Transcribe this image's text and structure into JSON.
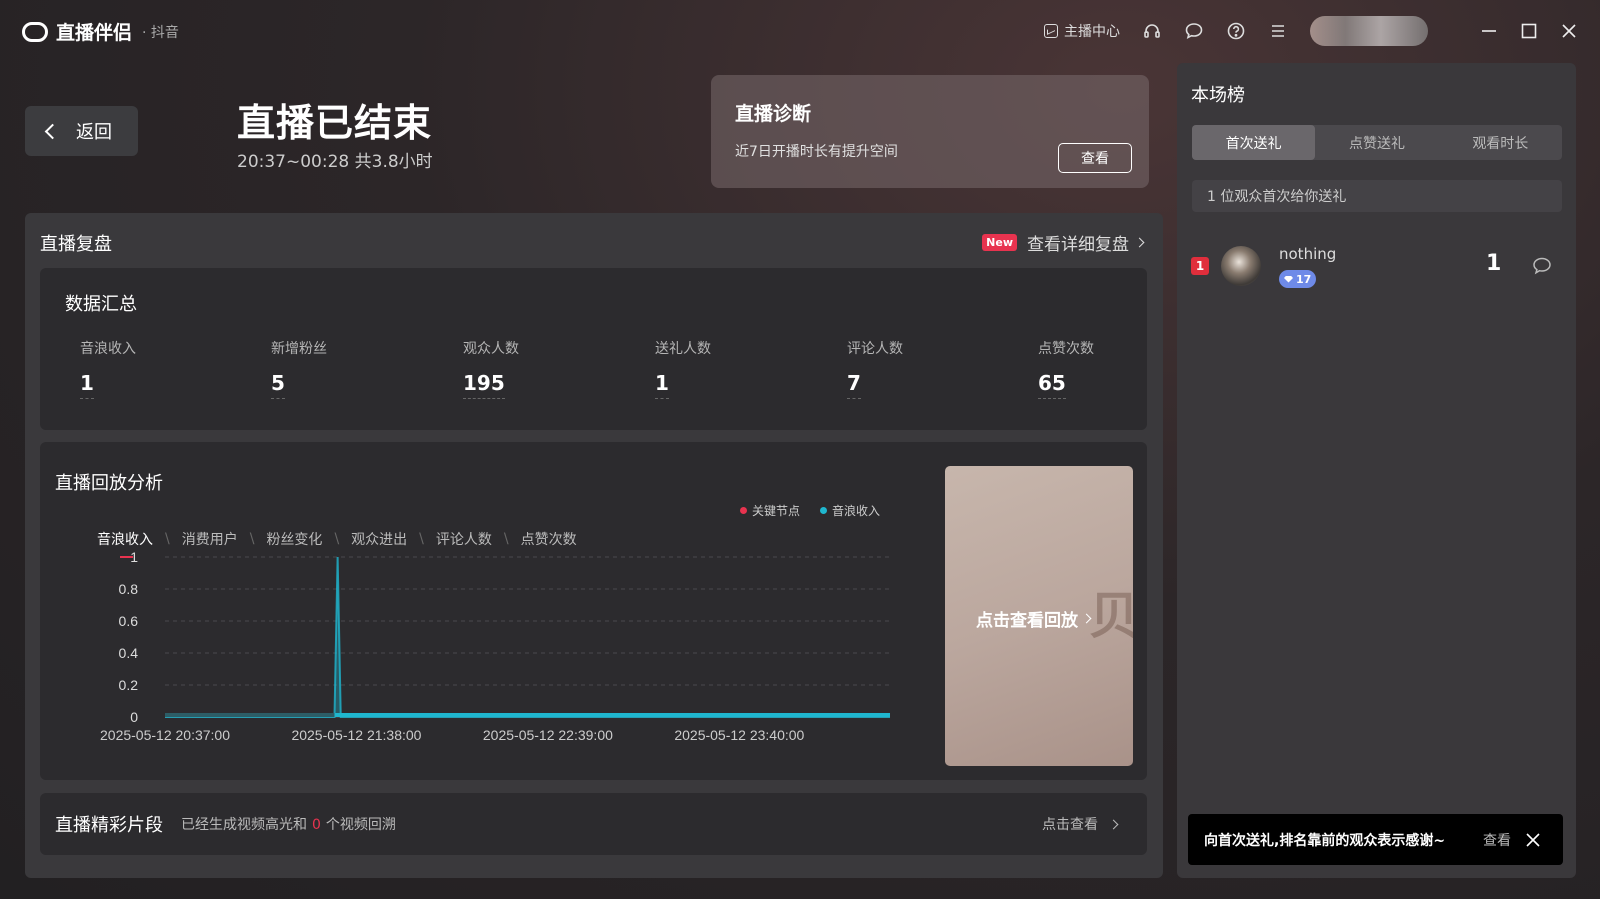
{
  "app": {
    "title": "直播伴侣",
    "platform": "· 抖音",
    "anchor_center": "主播中心"
  },
  "header": {
    "back_label": "返回",
    "status_title": "直播已结束",
    "time_range": "20:37~00:28 共3.8小时"
  },
  "diagnosis": {
    "title": "直播诊断",
    "desc": "近7日开播时长有提升空间",
    "button": "查看"
  },
  "review": {
    "title": "直播复盘",
    "new_badge": "New",
    "detail_link": "查看详细复盘",
    "summary": {
      "title": "数据汇总",
      "metrics": [
        {
          "label": "音浪收入",
          "value": "1"
        },
        {
          "label": "新增粉丝",
          "value": "5"
        },
        {
          "label": "观众人数",
          "value": "195"
        },
        {
          "label": "送礼人数",
          "value": "1"
        },
        {
          "label": "评论人数",
          "value": "7"
        },
        {
          "label": "点赞次数",
          "value": "65"
        }
      ]
    },
    "replay": {
      "title": "直播回放分析",
      "legend": [
        {
          "name": "关键节点",
          "color": "#e8334f"
        },
        {
          "name": "音浪收入",
          "color": "#1fb7cf"
        }
      ],
      "tabs": [
        "音浪收入",
        "消费用户",
        "粉丝变化",
        "观众进出",
        "评论人数",
        "点赞次数"
      ],
      "thumb_label": "点击查看回放"
    },
    "highlights": {
      "title": "直播精彩片段",
      "desc_prefix": "已经生成视频高光和",
      "count": "0",
      "desc_suffix": "个视频回溯",
      "link": "点击查看"
    }
  },
  "chart_data": {
    "type": "area",
    "x_ticks": [
      "2025-05-12 20:37:00",
      "2025-05-12 21:38:00",
      "2025-05-12 22:39:00",
      "2025-05-12 23:40:00"
    ],
    "y_ticks": [
      "0",
      "0.2",
      "0.4",
      "0.6",
      "0.8",
      "1"
    ],
    "ylim": [
      0,
      1
    ],
    "grid": true,
    "series": [
      {
        "name": "音浪收入",
        "color": "#1fb7cf",
        "x": [
          "2025-05-12 20:37:00",
          "2025-05-12 21:31:00",
          "2025-05-12 21:32:00",
          "2025-05-12 21:33:00",
          "2025-05-13 00:28:00"
        ],
        "values": [
          0,
          0,
          1,
          0,
          0
        ]
      }
    ]
  },
  "ranking": {
    "title": "本场榜",
    "tabs": [
      "首次送礼",
      "点赞送礼",
      "观看时长"
    ],
    "info": "1 位观众首次给你送礼",
    "rows": [
      {
        "rank": "1",
        "name": "nothing",
        "level": "17",
        "count": "1"
      }
    ]
  },
  "toast": {
    "text": "向首次送礼,排名靠前的观众表示感谢~",
    "link": "查看"
  }
}
